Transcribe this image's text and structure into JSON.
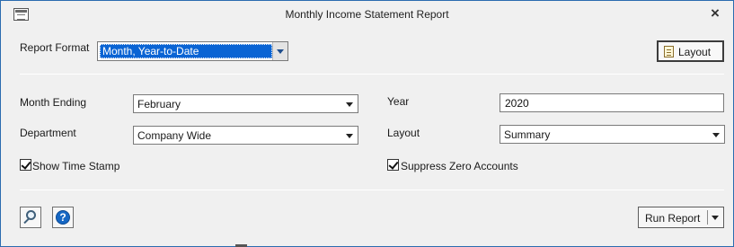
{
  "window": {
    "title": "Monthly Income Statement Report",
    "close_glyph": "×",
    "app_icon": "window-app-icon"
  },
  "report_format": {
    "label": "Report Format",
    "value": "Month, Year-to-Date"
  },
  "layout_button": {
    "label": "Layout",
    "icon": "layout-document-icon"
  },
  "month_ending": {
    "label": "Month Ending",
    "value": "February"
  },
  "year": {
    "label": "Year",
    "value": "2020"
  },
  "department": {
    "label": "Department",
    "value": "Company Wide"
  },
  "layout": {
    "label": "Layout",
    "value": "Summary"
  },
  "show_time_stamp": {
    "label": "Show Time Stamp",
    "checked": true
  },
  "suppress_zero_accounts": {
    "label": "Suppress Zero Accounts",
    "checked": true
  },
  "footer": {
    "search_icon": "magnifier-icon",
    "help_icon": "help-icon",
    "help_glyph": "?",
    "run_label": "Run Report"
  },
  "colors": {
    "selection": "#0a64d4",
    "window_border": "#2b6cb0",
    "help_blue": "#1667c4"
  }
}
